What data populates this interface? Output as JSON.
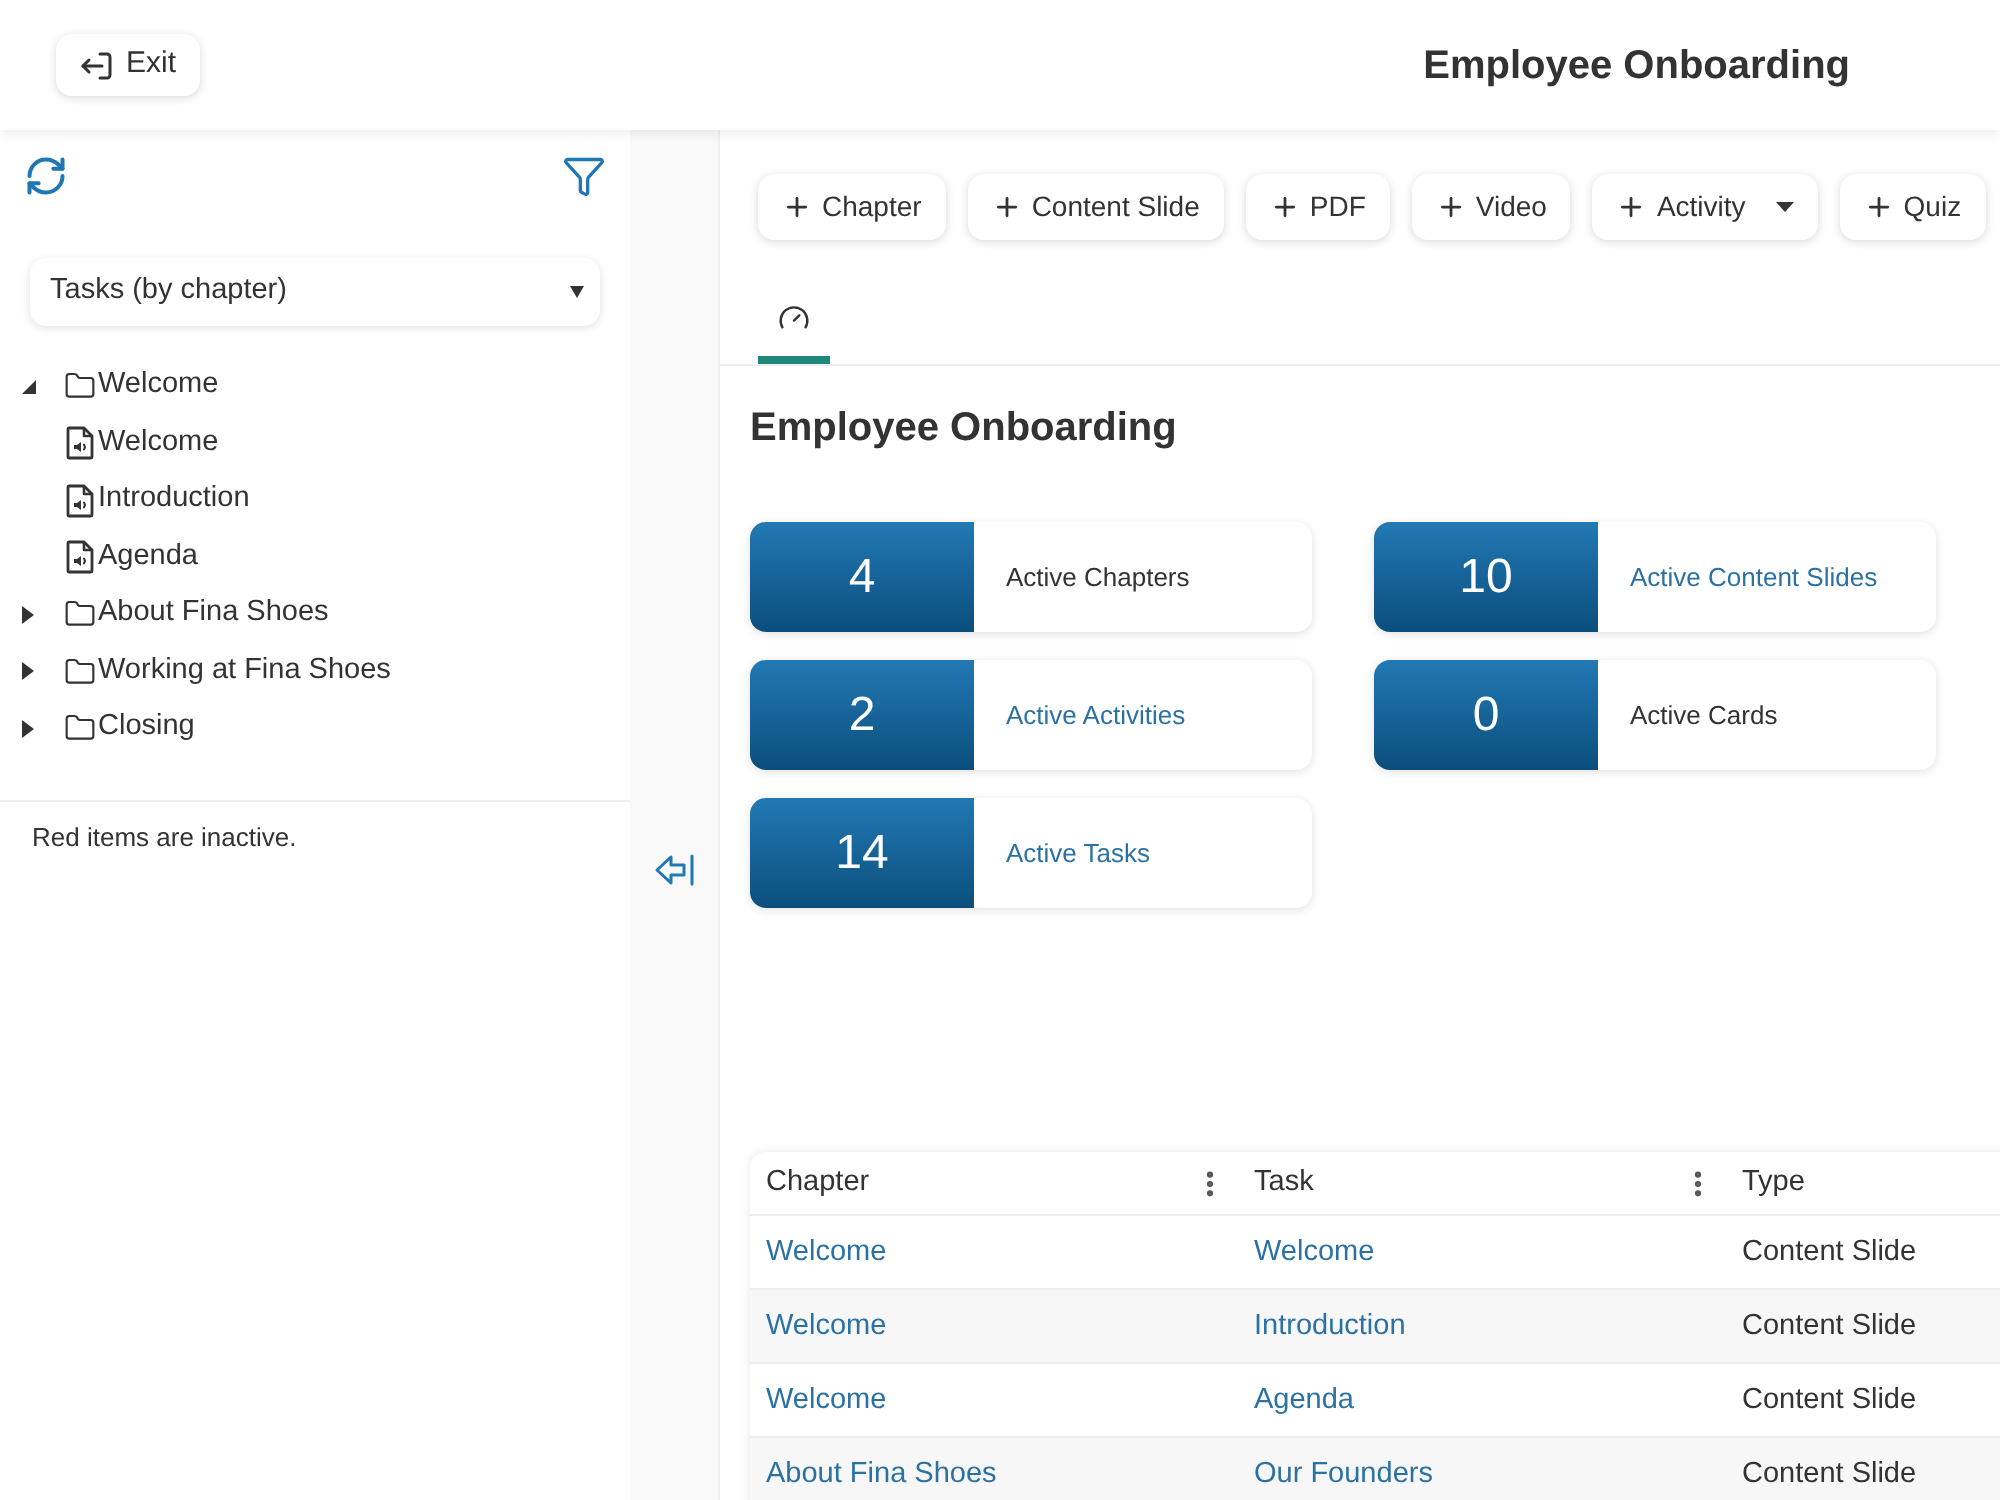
{
  "header": {
    "exit_button": "Exit",
    "title": "Employee Onboarding"
  },
  "sidebar": {
    "view_select": "Tasks (by chapter)",
    "tree": [
      {
        "label": "Welcome",
        "kind": "folder",
        "expanded": true,
        "children": [
          {
            "label": "Welcome",
            "kind": "slide"
          },
          {
            "label": "Introduction",
            "kind": "slide"
          },
          {
            "label": "Agenda",
            "kind": "slide"
          }
        ]
      },
      {
        "label": "About Fina Shoes",
        "kind": "folder",
        "expanded": false
      },
      {
        "label": "Working at Fina Shoes",
        "kind": "folder",
        "expanded": false
      },
      {
        "label": "Closing",
        "kind": "folder",
        "expanded": false
      }
    ],
    "note": "Red items are inactive."
  },
  "toolbar": [
    {
      "label": "Chapter",
      "menu": false
    },
    {
      "label": "Content Slide",
      "menu": false
    },
    {
      "label": "PDF",
      "menu": false
    },
    {
      "label": "Video",
      "menu": false
    },
    {
      "label": "Activity",
      "menu": true
    },
    {
      "label": "Quiz",
      "menu": false
    }
  ],
  "tabs": [
    {
      "selected": true
    }
  ],
  "heading": "Employee Onboarding",
  "stats": [
    {
      "count": "4",
      "label": "Active Chapters",
      "link": false
    },
    {
      "count": "10",
      "label": "Active Content Slides",
      "link": true
    },
    {
      "count": "2",
      "label": "Active Activities",
      "link": true
    },
    {
      "count": "0",
      "label": "Active Cards",
      "link": false
    },
    {
      "count": "14",
      "label": "Active Tasks",
      "link": true
    }
  ],
  "table": {
    "columns": [
      {
        "label": "Chapter",
        "menu": true
      },
      {
        "label": "Task",
        "menu": true
      },
      {
        "label": "Type",
        "menu": false
      }
    ],
    "rows": [
      {
        "chapter": "Welcome",
        "task": "Welcome",
        "type": "Content Slide"
      },
      {
        "chapter": "Welcome",
        "task": "Introduction",
        "type": "Content Slide"
      },
      {
        "chapter": "Welcome",
        "task": "Agenda",
        "type": "Content Slide"
      },
      {
        "chapter": "About Fina Shoes",
        "task": "Our Founders",
        "type": "Content Slide"
      }
    ]
  }
}
